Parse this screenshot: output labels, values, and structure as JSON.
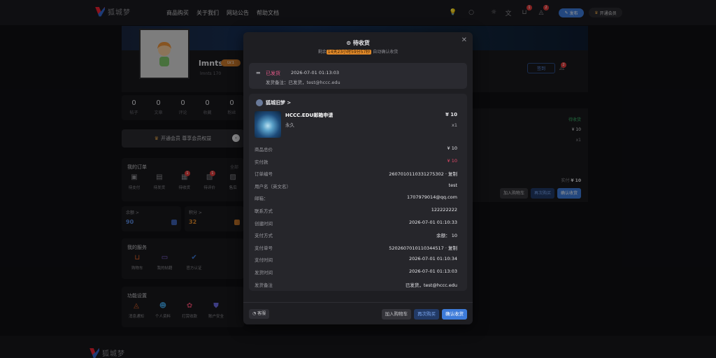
{
  "header": {
    "logo_text": "狐城梦",
    "nav": [
      "商品购买",
      "关于我们",
      "网站公告",
      "帮助文档"
    ],
    "cart_badge": "1",
    "bell_badge": "2",
    "publish_label": "发布",
    "vip_label": "开通会员"
  },
  "profile": {
    "username": "lmnts",
    "level": "LV.1",
    "uid": "lmnts  170",
    "follow_label": "签到",
    "bell_badge": "2",
    "stats": [
      {
        "n": "0",
        "l": "帖子"
      },
      {
        "n": "0",
        "l": "文章"
      },
      {
        "n": "0",
        "l": "评论"
      },
      {
        "n": "0",
        "l": "收藏"
      },
      {
        "n": "0",
        "l": "粉丝"
      }
    ],
    "vip_bar": "开通会员 尊享会员权益"
  },
  "orders_card": {
    "title": "我的订单",
    "more": "全部",
    "items": [
      {
        "label": "待支付",
        "badge": ""
      },
      {
        "label": "待发货",
        "badge": ""
      },
      {
        "label": "待收货",
        "badge": "1"
      },
      {
        "label": "待评价",
        "badge": "1"
      },
      {
        "label": "售后",
        "badge": ""
      }
    ]
  },
  "balance": {
    "label": "余额 >",
    "value": "90"
  },
  "points": {
    "label": "积分 >",
    "value": "32"
  },
  "services_card": {
    "title": "我的服务",
    "items": [
      "购物车",
      "我的帖籍",
      "官方认证"
    ]
  },
  "settings_card": {
    "title": "功能设置",
    "items": [
      "消息通知",
      "个人资料",
      "打赏收款",
      "账户安全"
    ]
  },
  "right_panel": {
    "status": "待收货",
    "price": "¥ 10",
    "qty": "x1",
    "pay_label": "实付",
    "pay_value": "¥ 10",
    "buttons": [
      "加入购物车",
      "再次购买",
      "确认收货"
    ]
  },
  "modal": {
    "title": "待收货",
    "sub_prefix": "剩余",
    "sub_highlight": "14天23小时59分57秒",
    "sub_suffix": "自动确认收货",
    "ship_status": "已发货",
    "ship_time": "2026-07-01 01:13:03",
    "ship_note": "发货备注：已发货，test@hccc.edu",
    "shop_name": "狐城旧梦 >",
    "product": {
      "name": "HCCC.EDU邮箱申请",
      "spec": "永久",
      "price": "¥ 10",
      "qty": "x1"
    },
    "rows": [
      {
        "k": "商品总价",
        "v": "¥ 10"
      },
      {
        "k": "实付款",
        "v": "¥ 10"
      },
      {
        "k": "订单编号",
        "v": "2607010110331275302 · 复制"
      },
      {
        "k": "用户名（英文名）",
        "v": "test"
      },
      {
        "k": "邮箱：",
        "v": "1707979014@qq.com"
      },
      {
        "k": "联系方式",
        "v": "122222222"
      },
      {
        "k": "创建时间",
        "v": "2026-07-01 01:10:33"
      },
      {
        "k": "支付方式",
        "v": "余额： 10"
      },
      {
        "k": "支付单号",
        "v": "5202607010110344517 · 复制"
      },
      {
        "k": "支付时间",
        "v": "2026-07-01 01:10:34"
      },
      {
        "k": "发货时间",
        "v": "2026-07-01 01:13:03"
      },
      {
        "k": "发货备注",
        "v": "已发货，test@hccc.edu"
      }
    ],
    "service_label": "客服",
    "buttons": [
      "加入购物车",
      "再次购买",
      "确认收货"
    ]
  },
  "colors": {
    "accent": "#3d7bd9",
    "danger": "#e84a6a",
    "gold": "#e0a24a"
  }
}
